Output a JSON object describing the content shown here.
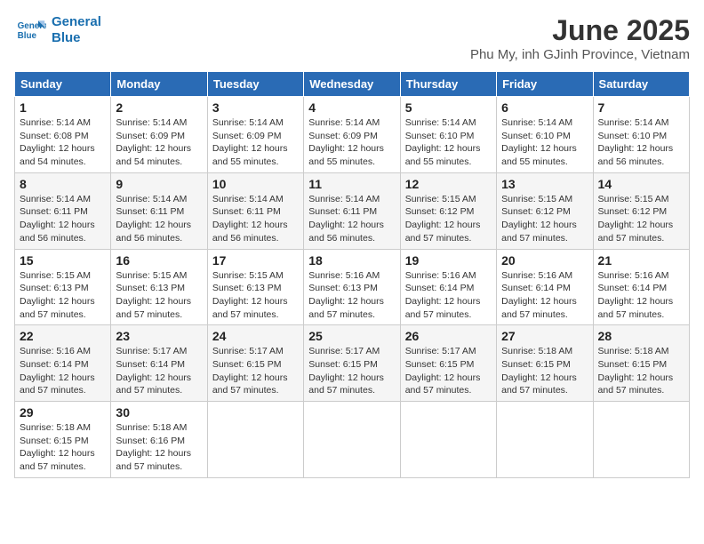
{
  "header": {
    "logo_line1": "General",
    "logo_line2": "Blue",
    "month": "June 2025",
    "location": "Phu My, inh GJinh Province, Vietnam"
  },
  "weekdays": [
    "Sunday",
    "Monday",
    "Tuesday",
    "Wednesday",
    "Thursday",
    "Friday",
    "Saturday"
  ],
  "weeks": [
    [
      {
        "day": "1",
        "info": "Sunrise: 5:14 AM\nSunset: 6:08 PM\nDaylight: 12 hours\nand 54 minutes."
      },
      {
        "day": "2",
        "info": "Sunrise: 5:14 AM\nSunset: 6:09 PM\nDaylight: 12 hours\nand 54 minutes."
      },
      {
        "day": "3",
        "info": "Sunrise: 5:14 AM\nSunset: 6:09 PM\nDaylight: 12 hours\nand 55 minutes."
      },
      {
        "day": "4",
        "info": "Sunrise: 5:14 AM\nSunset: 6:09 PM\nDaylight: 12 hours\nand 55 minutes."
      },
      {
        "day": "5",
        "info": "Sunrise: 5:14 AM\nSunset: 6:10 PM\nDaylight: 12 hours\nand 55 minutes."
      },
      {
        "day": "6",
        "info": "Sunrise: 5:14 AM\nSunset: 6:10 PM\nDaylight: 12 hours\nand 55 minutes."
      },
      {
        "day": "7",
        "info": "Sunrise: 5:14 AM\nSunset: 6:10 PM\nDaylight: 12 hours\nand 56 minutes."
      }
    ],
    [
      {
        "day": "8",
        "info": "Sunrise: 5:14 AM\nSunset: 6:11 PM\nDaylight: 12 hours\nand 56 minutes."
      },
      {
        "day": "9",
        "info": "Sunrise: 5:14 AM\nSunset: 6:11 PM\nDaylight: 12 hours\nand 56 minutes."
      },
      {
        "day": "10",
        "info": "Sunrise: 5:14 AM\nSunset: 6:11 PM\nDaylight: 12 hours\nand 56 minutes."
      },
      {
        "day": "11",
        "info": "Sunrise: 5:14 AM\nSunset: 6:11 PM\nDaylight: 12 hours\nand 56 minutes."
      },
      {
        "day": "12",
        "info": "Sunrise: 5:15 AM\nSunset: 6:12 PM\nDaylight: 12 hours\nand 57 minutes."
      },
      {
        "day": "13",
        "info": "Sunrise: 5:15 AM\nSunset: 6:12 PM\nDaylight: 12 hours\nand 57 minutes."
      },
      {
        "day": "14",
        "info": "Sunrise: 5:15 AM\nSunset: 6:12 PM\nDaylight: 12 hours\nand 57 minutes."
      }
    ],
    [
      {
        "day": "15",
        "info": "Sunrise: 5:15 AM\nSunset: 6:13 PM\nDaylight: 12 hours\nand 57 minutes."
      },
      {
        "day": "16",
        "info": "Sunrise: 5:15 AM\nSunset: 6:13 PM\nDaylight: 12 hours\nand 57 minutes."
      },
      {
        "day": "17",
        "info": "Sunrise: 5:15 AM\nSunset: 6:13 PM\nDaylight: 12 hours\nand 57 minutes."
      },
      {
        "day": "18",
        "info": "Sunrise: 5:16 AM\nSunset: 6:13 PM\nDaylight: 12 hours\nand 57 minutes."
      },
      {
        "day": "19",
        "info": "Sunrise: 5:16 AM\nSunset: 6:14 PM\nDaylight: 12 hours\nand 57 minutes."
      },
      {
        "day": "20",
        "info": "Sunrise: 5:16 AM\nSunset: 6:14 PM\nDaylight: 12 hours\nand 57 minutes."
      },
      {
        "day": "21",
        "info": "Sunrise: 5:16 AM\nSunset: 6:14 PM\nDaylight: 12 hours\nand 57 minutes."
      }
    ],
    [
      {
        "day": "22",
        "info": "Sunrise: 5:16 AM\nSunset: 6:14 PM\nDaylight: 12 hours\nand 57 minutes."
      },
      {
        "day": "23",
        "info": "Sunrise: 5:17 AM\nSunset: 6:14 PM\nDaylight: 12 hours\nand 57 minutes."
      },
      {
        "day": "24",
        "info": "Sunrise: 5:17 AM\nSunset: 6:15 PM\nDaylight: 12 hours\nand 57 minutes."
      },
      {
        "day": "25",
        "info": "Sunrise: 5:17 AM\nSunset: 6:15 PM\nDaylight: 12 hours\nand 57 minutes."
      },
      {
        "day": "26",
        "info": "Sunrise: 5:17 AM\nSunset: 6:15 PM\nDaylight: 12 hours\nand 57 minutes."
      },
      {
        "day": "27",
        "info": "Sunrise: 5:18 AM\nSunset: 6:15 PM\nDaylight: 12 hours\nand 57 minutes."
      },
      {
        "day": "28",
        "info": "Sunrise: 5:18 AM\nSunset: 6:15 PM\nDaylight: 12 hours\nand 57 minutes."
      }
    ],
    [
      {
        "day": "29",
        "info": "Sunrise: 5:18 AM\nSunset: 6:15 PM\nDaylight: 12 hours\nand 57 minutes."
      },
      {
        "day": "30",
        "info": "Sunrise: 5:18 AM\nSunset: 6:16 PM\nDaylight: 12 hours\nand 57 minutes."
      },
      {
        "day": "",
        "info": ""
      },
      {
        "day": "",
        "info": ""
      },
      {
        "day": "",
        "info": ""
      },
      {
        "day": "",
        "info": ""
      },
      {
        "day": "",
        "info": ""
      }
    ]
  ]
}
